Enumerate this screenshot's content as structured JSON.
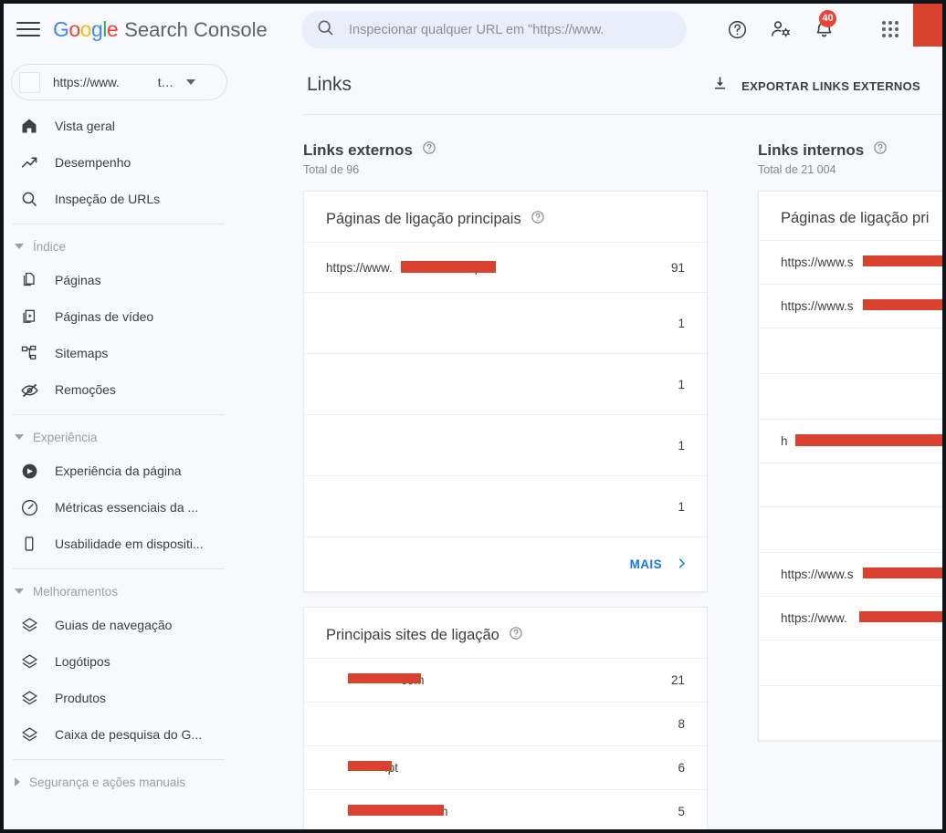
{
  "app": {
    "brand_google": "Google",
    "brand_product": "Search Console",
    "menu_icon": "hamburger-icon"
  },
  "search": {
    "placeholder": "Inspecionar qualquer URL em \"https://www.",
    "value": "",
    "icon": "search-icon"
  },
  "topbar": {
    "help_icon": "help-circle-icon",
    "account_icon": "account-settings-icon",
    "notifications_icon": "bell-icon",
    "notifications_count": "40",
    "apps_icon": "apps-grid-icon",
    "avatar": "avatar-redacted",
    "badge_color": "#ea4335"
  },
  "property": {
    "url": "https://www.",
    "tail": "t…",
    "icon": "property-site-icon",
    "caret": "chevron-down-icon"
  },
  "sidebar": {
    "items": [
      {
        "label": "Vista geral",
        "icon": "home-icon"
      },
      {
        "label": "Desempenho",
        "icon": "trending-up-icon"
      },
      {
        "label": "Inspeção de URLs",
        "icon": "search-icon"
      }
    ],
    "groups": [
      {
        "label": "Índice",
        "expanded": true,
        "items": [
          {
            "label": "Páginas",
            "icon": "pages-icon"
          },
          {
            "label": "Páginas de vídeo",
            "icon": "video-pages-icon"
          },
          {
            "label": "Sitemaps",
            "icon": "sitemap-icon"
          },
          {
            "label": "Remoções",
            "icon": "eye-off-icon"
          }
        ]
      },
      {
        "label": "Experiência",
        "expanded": true,
        "items": [
          {
            "label": "Experiência da página",
            "icon": "page-experience-icon"
          },
          {
            "label": "Métricas essenciais da ...",
            "icon": "core-vitals-gauge-icon"
          },
          {
            "label": "Usabilidade em dispositi...",
            "icon": "mobile-device-icon"
          }
        ]
      },
      {
        "label": "Melhoramentos",
        "expanded": true,
        "items": [
          {
            "label": "Guias de navegação",
            "icon": "layers-icon"
          },
          {
            "label": "Logótipos",
            "icon": "layers-icon"
          },
          {
            "label": "Produtos",
            "icon": "layers-icon"
          },
          {
            "label": "Caixa de pesquisa do G...",
            "icon": "layers-icon"
          }
        ]
      },
      {
        "label": "Segurança e ações manuais",
        "expanded": false,
        "items": []
      }
    ]
  },
  "main": {
    "page_title": "Links",
    "export_label": "EXPORTAR LINKS EXTERNOS",
    "export_icon": "download-icon"
  },
  "external": {
    "section_title": "Links externos",
    "section_total": "Total de 96",
    "help_icon": "help-circle-icon",
    "cards": [
      {
        "title": "Páginas de ligação principais",
        "help_icon": "help-circle-icon",
        "rows": [
          {
            "label_prefix": "https://www.",
            "label_suffix": "pt/",
            "redacted": true,
            "value": "91"
          },
          {
            "label_prefix": "",
            "label_suffix": "",
            "redacted": true,
            "value": "1"
          },
          {
            "label_prefix": "",
            "label_suffix": "",
            "redacted": true,
            "value": "1"
          },
          {
            "label_prefix": "",
            "label_suffix": "",
            "redacted": true,
            "value": "1"
          },
          {
            "label_prefix": "",
            "label_suffix": "",
            "redacted": true,
            "value": "1"
          }
        ],
        "more_label": "MAIS",
        "more_icon": "chevron-right-icon"
      },
      {
        "title": "Principais sites de ligação",
        "help_icon": "help-circle-icon",
        "rows": [
          {
            "label_prefix": "",
            "label_suffix": "com",
            "redacted": true,
            "value": "21"
          },
          {
            "label_prefix": "",
            "label_suffix": "",
            "redacted": true,
            "value": "8"
          },
          {
            "label_prefix": "",
            "label_suffix": ".pt",
            "redacted": true,
            "value": "6"
          },
          {
            "label_prefix": "",
            "label_suffix": "com",
            "redacted": true,
            "value": "5"
          }
        ]
      }
    ]
  },
  "internal": {
    "section_title": "Links internos",
    "section_total": "Total de 21 004",
    "help_icon": "help-circle-icon",
    "cards": [
      {
        "title": "Páginas de ligação pri",
        "rows": [
          {
            "label_prefix": "https://www.s",
            "redacted": true
          },
          {
            "label_prefix": "https://www.s",
            "redacted": true
          },
          {
            "label_prefix": "",
            "redacted": true
          },
          {
            "label_prefix": "",
            "redacted": true
          },
          {
            "label_prefix": "h",
            "redacted": true
          },
          {
            "label_prefix": "",
            "redacted": true
          },
          {
            "label_prefix": "",
            "redacted": true
          },
          {
            "label_prefix": "https://www.s",
            "redacted": true
          },
          {
            "label_prefix": "https://www.",
            "redacted": true
          },
          {
            "label_prefix": "",
            "redacted": true
          }
        ]
      }
    ]
  },
  "colors": {
    "redaction": "#d9422f",
    "accent_link": "#1a73e8",
    "page_bg": "#f7f9fc",
    "card_bg": "#ffffff"
  }
}
